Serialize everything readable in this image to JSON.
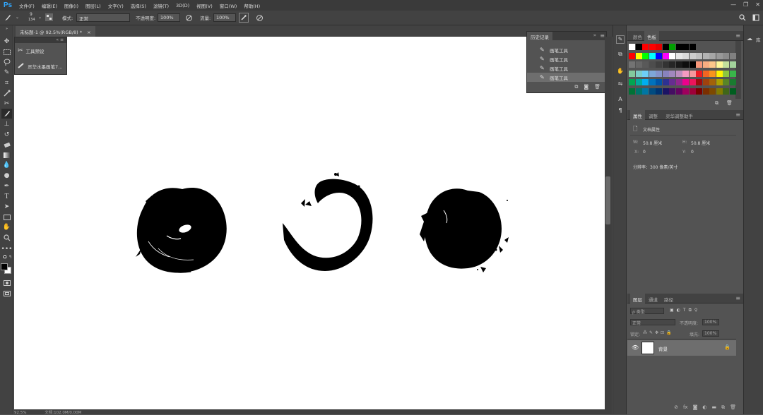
{
  "app_logo": "Ps",
  "menu": [
    "文件(F)",
    "编辑(E)",
    "图像(I)",
    "图层(L)",
    "文字(Y)",
    "选择(S)",
    "滤镜(T)",
    "3D(D)",
    "视图(V)",
    "窗口(W)",
    "帮助(H)"
  ],
  "window_controls": [
    "—",
    "❐",
    "✕"
  ],
  "options": {
    "brush_size": "9",
    "brush_size2": "134",
    "mode_label": "模式:",
    "mode_value": "正常",
    "opacity_label": "不透明度:",
    "opacity_value": "100%",
    "flow_label": "流量:",
    "flow_value": "100%"
  },
  "document_tab": {
    "title": "未标题-1 @ 92.5%(RGB/8) *",
    "close": "×"
  },
  "status": {
    "zoom": "92.5%",
    "doc": "文档:102.0M/0.00M"
  },
  "tool_preset": {
    "header": "«  ≡",
    "item1": "工具预设",
    "item2": "灵华水墨画笔7..."
  },
  "history": {
    "tab": "历史记录",
    "items": [
      "画笔工具",
      "画笔工具",
      "画笔工具",
      "画笔工具"
    ]
  },
  "color_panel": {
    "tabs": [
      "颜色",
      "色板"
    ]
  },
  "swatch_colors": [
    [
      "#ffffff",
      "#000000",
      "#ff0000",
      "#ff0000",
      "#e60000",
      "#000000",
      "#00a000",
      "#000000",
      "#000000",
      "#000000"
    ],
    [
      "#ff0000",
      "#ffff00",
      "#00ff00",
      "#00ffff",
      "#0000ff",
      "#ff00ff",
      "#ffffff",
      "#e6e6e6",
      "#d9d9d9",
      "#cccccc",
      "#bfbfbf",
      "#b3b3b3",
      "#a6a6a6",
      "#999999",
      "#8c8c8c",
      "#808080"
    ],
    [
      "#737373",
      "#666666",
      "#595959",
      "#4d4d4d",
      "#404040",
      "#333333",
      "#262626",
      "#1a1a1a",
      "#0d0d0d",
      "#000000",
      "#f7977a",
      "#f9ad81",
      "#fdc68a",
      "#fff79a",
      "#c4df9b",
      "#a3d39c"
    ],
    [
      "#82ca9d",
      "#7bcdc8",
      "#6ecff6",
      "#7ea7d8",
      "#8493ca",
      "#8882be",
      "#a187be",
      "#bc8dbf",
      "#f49ac2",
      "#f6989d",
      "#ed1c24",
      "#f26522",
      "#f7941d",
      "#fff200",
      "#8dc63f",
      "#39b54a"
    ],
    [
      "#00a651",
      "#00a99d",
      "#00aeef",
      "#0072bc",
      "#0054a6",
      "#2e3192",
      "#662d91",
      "#92278f",
      "#ec008c",
      "#ed145b",
      "#9e0b0f",
      "#a0410d",
      "#a36209",
      "#aba000",
      "#598527",
      "#197b30"
    ],
    [
      "#007236",
      "#00746b",
      "#0076a3",
      "#004b80",
      "#003471",
      "#1b1464",
      "#440e62",
      "#630460",
      "#9e005d",
      "#9e0039",
      "#790000",
      "#7b2e00",
      "#7d4900",
      "#827b00",
      "#406618",
      "#005e20"
    ]
  ],
  "properties": {
    "tabs": [
      "属性",
      "调整",
      "灵华调整助手"
    ],
    "section": "文档属性",
    "w_label": "W:",
    "w_value": "50.8 厘米",
    "h_label": "H:",
    "h_value": "50.8 厘米",
    "x_label": "X:",
    "x_value": "0",
    "y_label": "Y:",
    "y_value": "0",
    "resolution": "分辨率：300 像素/英寸"
  },
  "layers": {
    "tabs": [
      "图层",
      "通道",
      "路径"
    ],
    "kind": "ρ 类型",
    "blend": "正常",
    "opacity_label": "不透明度:",
    "opacity_value": "100%",
    "lock_label": "锁定:",
    "fill_label": "填充:",
    "fill_value": "100%",
    "layer_name": "背景"
  },
  "far_right_label": "库"
}
